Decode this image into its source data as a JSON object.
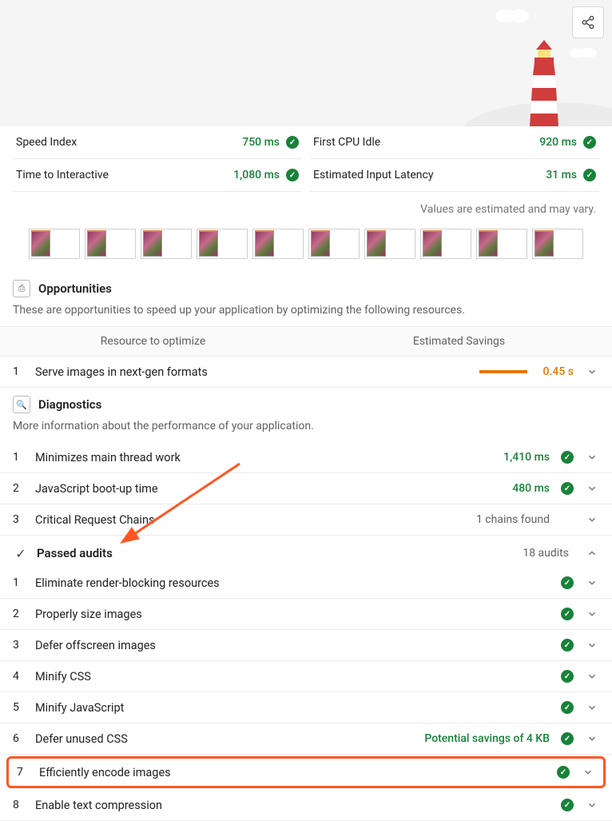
{
  "share_label": "Share",
  "metrics": {
    "left": [
      {
        "label": "Speed Index",
        "value": "750 ms"
      },
      {
        "label": "Time to Interactive",
        "value": "1,080 ms"
      }
    ],
    "right": [
      {
        "label": "First CPU Idle",
        "value": "920 ms"
      },
      {
        "label": "Estimated Input Latency",
        "value": "31 ms"
      }
    ]
  },
  "estimate_note": "Values are estimated and may vary.",
  "opportunities": {
    "title": "Opportunities",
    "desc": "These are opportunities to speed up your application by optimizing the following resources.",
    "col1": "Resource to optimize",
    "col2": "Estimated Savings",
    "items": [
      {
        "idx": "1",
        "name": "Serve images in next-gen formats",
        "value": "0.45 s"
      }
    ]
  },
  "diagnostics": {
    "title": "Diagnostics",
    "desc": "More information about the performance of your application.",
    "items": [
      {
        "idx": "1",
        "name": "Minimizes main thread work",
        "value": "1,410 ms",
        "pass": true
      },
      {
        "idx": "2",
        "name": "JavaScript boot-up time",
        "value": "480 ms",
        "pass": true
      },
      {
        "idx": "3",
        "name": "Critical Request Chains",
        "value": "1 chains found",
        "pass": false
      }
    ]
  },
  "passed": {
    "title": "Passed audits",
    "count": "18 audits",
    "items": [
      {
        "idx": "1",
        "name": "Eliminate render-blocking resources"
      },
      {
        "idx": "2",
        "name": "Properly size images"
      },
      {
        "idx": "3",
        "name": "Defer offscreen images"
      },
      {
        "idx": "4",
        "name": "Minify CSS"
      },
      {
        "idx": "5",
        "name": "Minify JavaScript"
      },
      {
        "idx": "6",
        "name": "Defer unused CSS",
        "extra": "Potential savings of 4 KB"
      },
      {
        "idx": "7",
        "name": "Efficiently encode images",
        "highlighted": true
      },
      {
        "idx": "8",
        "name": "Enable text compression"
      }
    ]
  }
}
